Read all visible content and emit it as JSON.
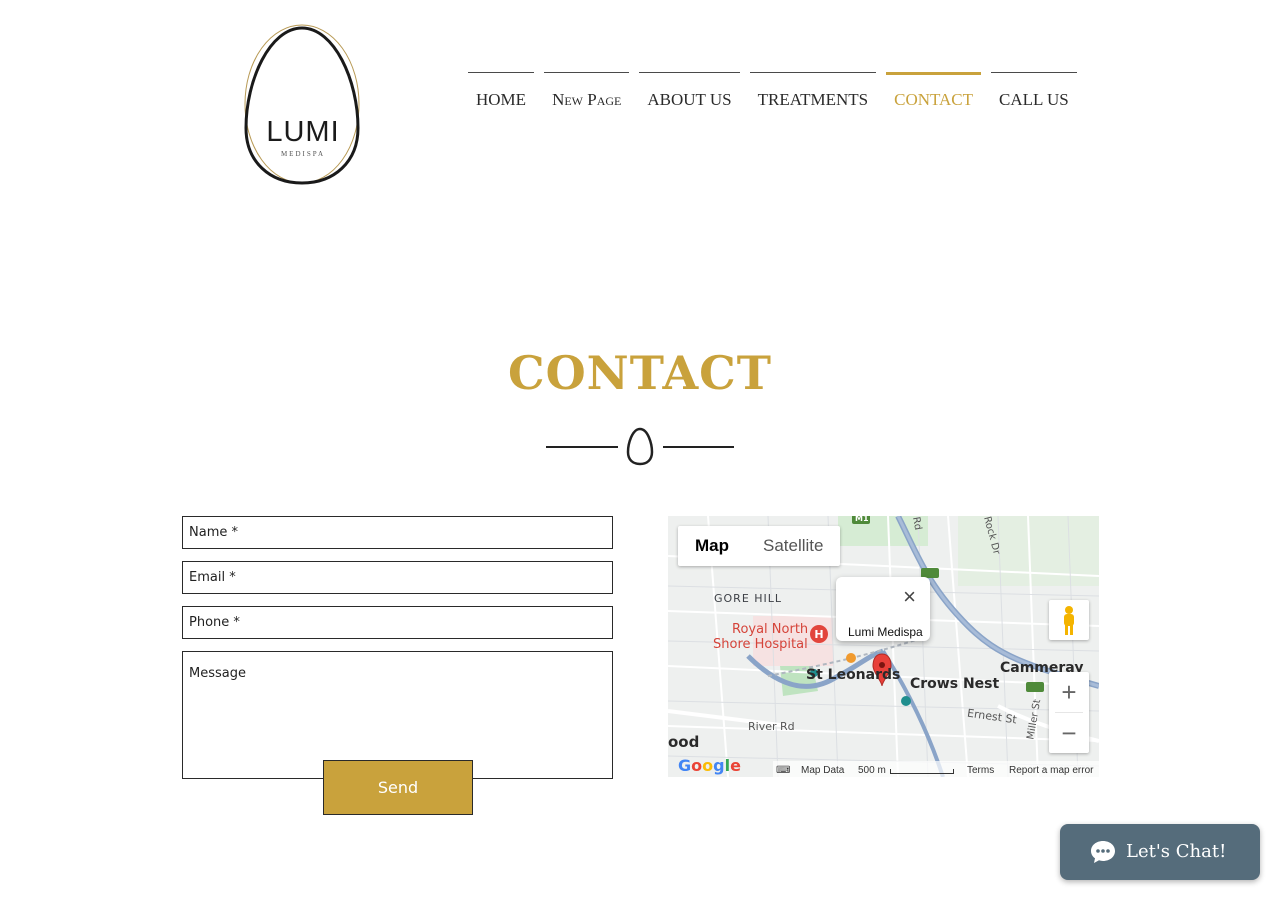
{
  "logo": {
    "text": "LUMI",
    "subtext": "MEDISPA"
  },
  "nav": {
    "items": [
      {
        "label": "HOME"
      },
      {
        "label": "New Page"
      },
      {
        "label": "ABOUT US"
      },
      {
        "label": "TREATMENTS"
      },
      {
        "label": "CONTACT",
        "active": true
      },
      {
        "label": "CALL US"
      }
    ]
  },
  "page": {
    "title": "CONTACT"
  },
  "form": {
    "name_placeholder": "Name *",
    "email_placeholder": "Email *",
    "phone_placeholder": "Phone *",
    "message_placeholder": "Message",
    "send_label": "Send"
  },
  "map": {
    "toggle_map": "Map",
    "toggle_satellite": "Satellite",
    "info_place": "Lumi Medispa",
    "close_symbol": "×",
    "labels": {
      "gore_hill": "GORE HILL",
      "royal_north_1": "Royal North",
      "royal_north_2": "Shore Hospital",
      "st_leonards": "St Leonards",
      "crows_nest": "Crows Nest",
      "cammeray": "Cammeray",
      "river_rd": "River Rd",
      "ernest_st": "Ernest St",
      "wood": "ood",
      "rock_dr": "Rock Dr",
      "rd": "Rd",
      "miller_st": "Miller St",
      "m1": "M1"
    },
    "footer": {
      "map_data": "Map Data",
      "scale": "500 m",
      "terms": "Terms",
      "report": "Report a map error"
    },
    "zoom_in": "+",
    "zoom_out": "−"
  },
  "chat": {
    "label": "Let's Chat!"
  },
  "colors": {
    "accent": "#c9a23c",
    "chat_bg": "#556c7b"
  }
}
